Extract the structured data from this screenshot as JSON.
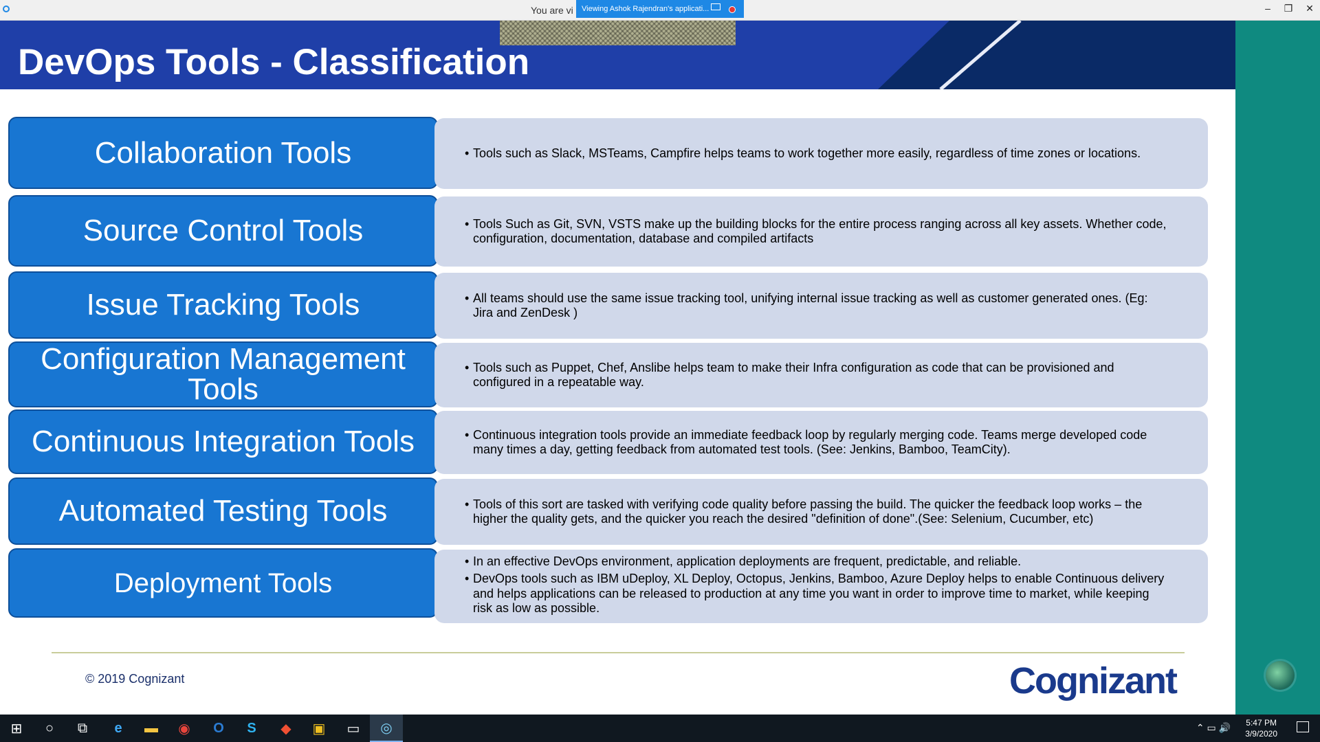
{
  "window": {
    "viewing_text": "You are vi",
    "banner_text": "Viewing Ashok Rajendran's applicati...",
    "minimize_glyph": "–",
    "restore_glyph": "❐",
    "close_glyph": "✕"
  },
  "slide": {
    "title": "DevOps Tools - Classification",
    "rows": [
      {
        "label": "Collaboration Tools",
        "bullets": [
          "Tools such as Slack, MSTeams, Campfire helps teams to work together more easily, regardless of time zones or locations."
        ]
      },
      {
        "label": "Source Control Tools",
        "bullets": [
          "Tools Such as Git, SVN, VSTS make up the building blocks for the entire process ranging across all key assets. Whether code, configuration, documentation, database and compiled artifacts"
        ]
      },
      {
        "label": "Issue Tracking Tools",
        "bullets": [
          "All teams should use the same issue tracking tool, unifying internal issue tracking as well as customer generated ones. (Eg: Jira and ZenDesk )"
        ]
      },
      {
        "label": "Configuration Management Tools",
        "bullets": [
          "Tools such as Puppet, Chef, Anslibe helps team to make their Infra configuration as code that can be provisioned and configured in a repeatable way."
        ]
      },
      {
        "label": "Continuous Integration Tools",
        "bullets": [
          "Continuous integration tools provide an immediate feedback loop by regularly merging code. Teams merge developed code many times a day, getting feedback from automated test tools. (See: Jenkins, Bamboo, TeamCity)."
        ]
      },
      {
        "label": "Automated Testing Tools",
        "bullets": [
          "Tools of this sort are tasked with verifying code quality before passing the build. The quicker the feedback loop works – the higher the quality gets, and the quicker you reach the desired \"definition of done\".(See: Selenium, Cucumber, etc)"
        ]
      },
      {
        "label": "Deployment Tools",
        "bullets": [
          "In an effective DevOps environment, application deployments are frequent, predictable, and reliable.",
          "DevOps tools such as IBM uDeploy, XL Deploy, Octopus, Jenkins, Bamboo, Azure Deploy helps to enable Continuous delivery and helps applications can be released to production at any time you want in order to improve time to market, while keeping risk as low as possible."
        ]
      }
    ],
    "copyright": "© 2019 Cognizant",
    "logo_text": "Cognizant"
  },
  "taskbar": {
    "items": [
      {
        "icon": "windows-start-icon",
        "glyph": "⊞"
      },
      {
        "icon": "search-icon",
        "glyph": "○"
      },
      {
        "icon": "task-view-icon",
        "glyph": "⧉"
      },
      {
        "icon": "edge-browser-icon",
        "glyph": "e"
      },
      {
        "icon": "file-explorer-icon",
        "glyph": "▬"
      },
      {
        "icon": "chrome-icon",
        "glyph": "◉"
      },
      {
        "icon": "outlook-icon",
        "glyph": "O"
      },
      {
        "icon": "skype-icon",
        "glyph": "S"
      },
      {
        "icon": "git-icon",
        "glyph": "◆"
      },
      {
        "icon": "sticky-app-icon",
        "glyph": "▣"
      },
      {
        "icon": "terminal-icon",
        "glyph": "▭"
      },
      {
        "icon": "webex-icon",
        "glyph": "◎"
      }
    ],
    "tray_glyphs": "⌃  ▭  🔊",
    "time": "5:47 PM",
    "date": "3/9/2020"
  },
  "colors": {
    "header_blue": "#1f3fa8",
    "label_blue": "#1876d2",
    "desc_bg": "#d0d8ea",
    "teal": "#0f8a80"
  }
}
